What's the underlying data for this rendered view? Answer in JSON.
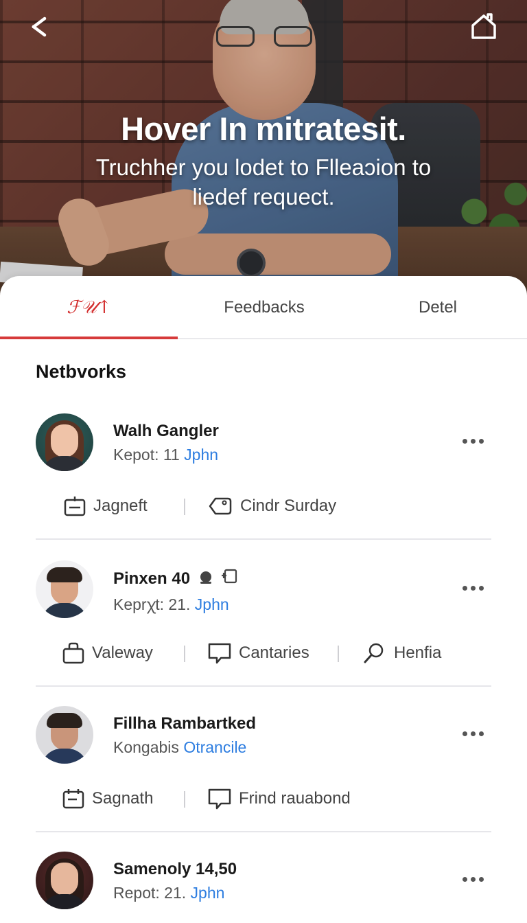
{
  "hero": {
    "title": "Hover In mitratesit.",
    "subtitle": "Truchher you lodet to Flleaɔion to liedef requect."
  },
  "tabs": [
    {
      "label": "ℱ𝒰↑",
      "active": true
    },
    {
      "label": "Feedbacks",
      "active": false
    },
    {
      "label": "Detel",
      "active": false
    }
  ],
  "section_title": "Netbvorks",
  "contacts": [
    {
      "name": "Walh Gangler",
      "meta_prefix": "Kepot: 11 ",
      "meta_link": "Jphn",
      "actions": [
        {
          "icon": "calendar-icon",
          "label": "Jagneft"
        },
        {
          "icon": "tag-icon",
          "label": "Cindr Surday"
        }
      ]
    },
    {
      "name": "Pinxen 40",
      "meta_prefix": "Keprꭓt: 21. ",
      "meta_link": "Jphn",
      "actions": [
        {
          "icon": "bag-icon",
          "label": "Valeway"
        },
        {
          "icon": "chat-icon",
          "label": "Cantaries"
        },
        {
          "icon": "search-icon",
          "label": "Henfia"
        }
      ]
    },
    {
      "name": "Fillha Rambartked",
      "meta_prefix": "Kongabis ",
      "meta_link": "Otrancile",
      "actions": [
        {
          "icon": "calendar-icon",
          "label": "Sagnath"
        },
        {
          "icon": "chat-icon",
          "label": "Frind rauabond"
        }
      ]
    },
    {
      "name": "Samenoly 14,50",
      "meta_prefix": "Repot: 21. ",
      "meta_link": "Jphn",
      "actions": []
    }
  ],
  "colors": {
    "accent": "#d63a3a",
    "link": "#2d7de0"
  }
}
